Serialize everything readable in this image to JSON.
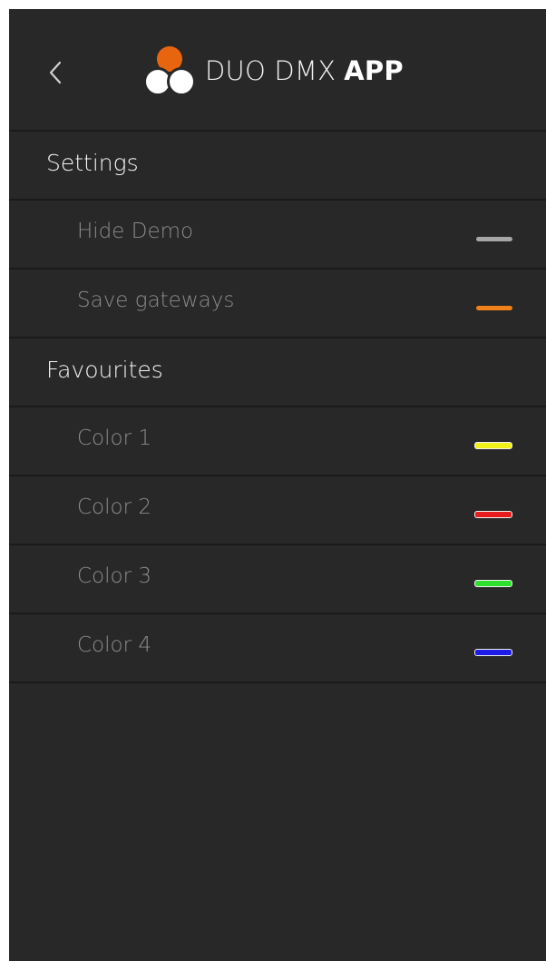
{
  "header": {
    "back_icon": "chevron-left-icon",
    "logo_icon": "three-circles-logo",
    "title_light": "DUO DMX",
    "title_bold": "APP"
  },
  "settings": {
    "title": "Settings",
    "items": [
      {
        "label": "Hide Demo",
        "indicator_color": "#a6a6a6"
      },
      {
        "label": "Save gateways",
        "indicator_color": "#f08019"
      }
    ]
  },
  "favourites": {
    "title": "Favourites",
    "items": [
      {
        "label": "Color 1",
        "color": "#f2f21a"
      },
      {
        "label": "Color 2",
        "color": "#e81c1c"
      },
      {
        "label": "Color 3",
        "color": "#2ee02e"
      },
      {
        "label": "Color 4",
        "color": "#1c1ce6"
      }
    ]
  },
  "colors": {
    "background": "#282828",
    "divider": "#1a1a1a",
    "accent": "#e8650f"
  }
}
